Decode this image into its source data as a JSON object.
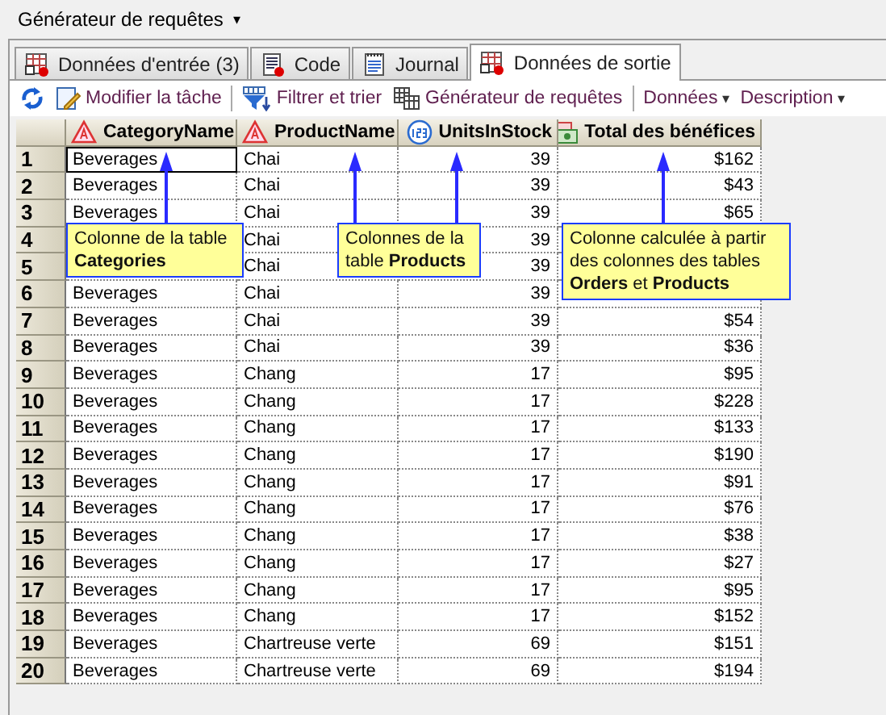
{
  "header": {
    "title": "Générateur de requêtes",
    "caret": "▾"
  },
  "tabs": [
    {
      "label": "Données d'entrée (3)",
      "kind": "data",
      "selected": false
    },
    {
      "label": "Code",
      "kind": "code",
      "selected": false
    },
    {
      "label": "Journal",
      "kind": "log",
      "selected": false
    },
    {
      "label": "Données de sortie",
      "kind": "data",
      "selected": true
    }
  ],
  "toolbar": [
    {
      "kind": "refresh"
    },
    {
      "kind": "edit",
      "label": "Modifier la tâche"
    },
    {
      "kind": "separator"
    },
    {
      "kind": "filter",
      "label": "Filtrer et trier"
    },
    {
      "kind": "query",
      "label": "Générateur de requêtes"
    },
    {
      "kind": "separator"
    },
    {
      "kind": "dropdown",
      "label": "Données",
      "caret": "▾"
    },
    {
      "kind": "dropdown",
      "label": "Description",
      "caret": "▾"
    }
  ],
  "table": {
    "columns": [
      {
        "name": "CategoryName",
        "kind": "text"
      },
      {
        "name": "ProductName",
        "kind": "text"
      },
      {
        "name": "UnitsInStock",
        "kind": "number"
      },
      {
        "name": "Total des bénéfices",
        "kind": "currency"
      }
    ],
    "rows": [
      {
        "number": "1",
        "focused": true,
        "cells": [
          "Beverages",
          "Chai",
          "39",
          "$162"
        ]
      },
      {
        "number": "2",
        "focused": false,
        "cells": [
          "Beverages",
          "Chai",
          "39",
          "$43"
        ]
      },
      {
        "number": "3",
        "focused": false,
        "cells": [
          "Beverages",
          "Chai",
          "39",
          "$65"
        ]
      },
      {
        "number": "4",
        "cells": [
          null,
          "Chai",
          "39",
          null
        ]
      },
      {
        "number": "5",
        "cells": [
          null,
          "Chai",
          "39",
          null
        ]
      },
      {
        "number": "6",
        "cells": [
          "Beverages",
          "Chai",
          "39",
          null
        ]
      },
      {
        "number": "7",
        "focused": false,
        "cells": [
          "Beverages",
          "Chai",
          "39",
          "$54"
        ]
      },
      {
        "number": "8",
        "focused": false,
        "cells": [
          "Beverages",
          "Chai",
          "39",
          "$36"
        ]
      },
      {
        "number": "9",
        "focused": false,
        "cells": [
          "Beverages",
          "Chang",
          "17",
          "$95"
        ]
      },
      {
        "number": "10",
        "focused": false,
        "cells": [
          "Beverages",
          "Chang",
          "17",
          "$228"
        ]
      },
      {
        "number": "11",
        "focused": false,
        "cells": [
          "Beverages",
          "Chang",
          "17",
          "$133"
        ]
      },
      {
        "number": "12",
        "focused": false,
        "cells": [
          "Beverages",
          "Chang",
          "17",
          "$190"
        ]
      },
      {
        "number": "13",
        "focused": false,
        "cells": [
          "Beverages",
          "Chang",
          "17",
          "$91"
        ]
      },
      {
        "number": "14",
        "focused": false,
        "cells": [
          "Beverages",
          "Chang",
          "17",
          "$76"
        ]
      },
      {
        "number": "15",
        "focused": false,
        "cells": [
          "Beverages",
          "Chang",
          "17",
          "$38"
        ]
      },
      {
        "number": "16",
        "focused": false,
        "cells": [
          "Beverages",
          "Chang",
          "17",
          "$27"
        ]
      },
      {
        "number": "17",
        "focused": false,
        "cells": [
          "Beverages",
          "Chang",
          "17",
          "$95"
        ]
      },
      {
        "number": "18",
        "focused": false,
        "cells": [
          "Beverages",
          "Chang",
          "17",
          "$152"
        ]
      },
      {
        "number": "19",
        "focused": false,
        "cells": [
          "Beverages",
          "Chartreuse verte",
          "69",
          "$151"
        ]
      },
      {
        "number": "20",
        "focused": false,
        "cells": [
          "Beverages",
          "Chartreuse verte",
          "69",
          "$194"
        ]
      }
    ]
  },
  "callouts": [
    {
      "text": "Colonne de la table\n**Categories**"
    },
    {
      "text": "Colonnes de la\ntable **Products**"
    },
    {
      "text": "Colonne calculée à partir\ndes colonnes des tables\n**Orders** et **Products**"
    }
  ]
}
